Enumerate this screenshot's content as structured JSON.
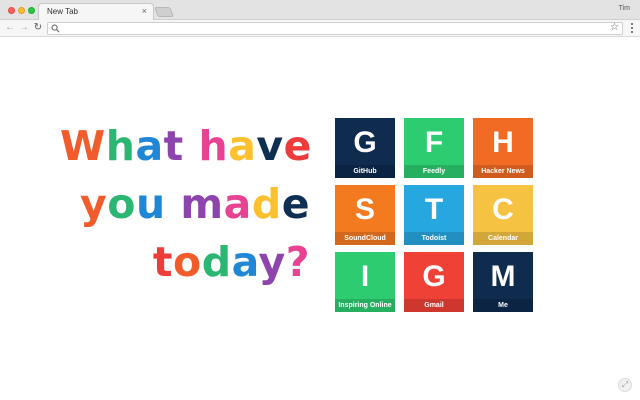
{
  "browser": {
    "tab_title": "New Tab",
    "tab_close": "×",
    "profile_name": "Tim",
    "back": "←",
    "forward": "→",
    "reload": "↻",
    "omnibox_value": "",
    "star": "☆"
  },
  "headline": {
    "lines": [
      "What have",
      "you made",
      "today?"
    ],
    "palette": [
      "#f25c2c",
      "#2bb673",
      "#1f87d6",
      "#8e44ad",
      "#e84393",
      "#fdc02e",
      "#0f2f52",
      "#ee3b3b"
    ]
  },
  "tiles": [
    {
      "letter": "G",
      "label": "GitHub",
      "color": "#0f2b4e"
    },
    {
      "letter": "F",
      "label": "Feedly",
      "color": "#2ecc71"
    },
    {
      "letter": "H",
      "label": "Hacker News",
      "color": "#f26b24"
    },
    {
      "letter": "S",
      "label": "SoundCloud",
      "color": "#f47a20"
    },
    {
      "letter": "T",
      "label": "Todoist",
      "color": "#27a7e0"
    },
    {
      "letter": "C",
      "label": "Calendar",
      "color": "#f5c242"
    },
    {
      "letter": "I",
      "label": "Inspiring Online",
      "color": "#2ecc71"
    },
    {
      "letter": "G",
      "label": "Gmail",
      "color": "#ef4136"
    },
    {
      "letter": "M",
      "label": "Me",
      "color": "#0f2b4e"
    }
  ],
  "corner_icon": "expand-icon"
}
